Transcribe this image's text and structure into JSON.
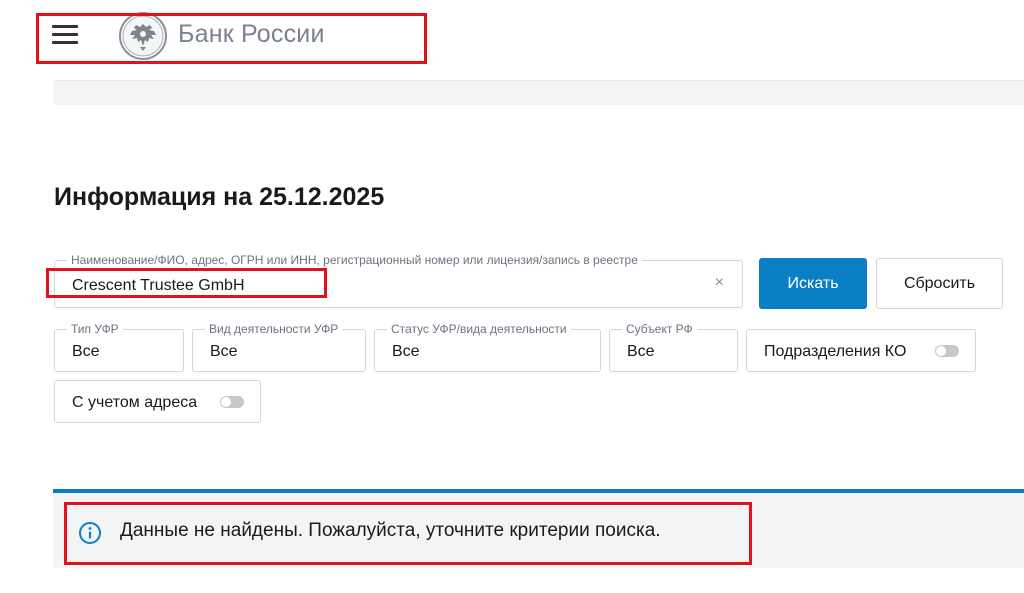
{
  "header": {
    "logo_text": "Банк России",
    "highlight_color": "#e0121b"
  },
  "page": {
    "title": "Информация на 25.12.2025"
  },
  "search": {
    "label": "Наименование/ФИО, адрес, ОГРН или ИНН, регистрационный номер или лицензия/запись в реестре",
    "value": "Crescent Trustee GmbH",
    "clear_glyph": "×",
    "search_button": "Искать",
    "reset_button": "Сбросить"
  },
  "filters": [
    {
      "label": "Тип УФР",
      "value": "Все"
    },
    {
      "label": "Вид деятельности УФР",
      "value": "Все"
    },
    {
      "label": "Статус УФР/вида деятельности",
      "value": "Все"
    },
    {
      "label": "Субъект РФ",
      "value": "Все"
    }
  ],
  "toggles": {
    "branches": {
      "label": "Подразделения КО",
      "on": false
    },
    "address": {
      "label": "С учетом адреса",
      "on": false
    }
  },
  "notice": {
    "icon": "info-icon",
    "text": "Данные не найдены. Пожалуйста, уточните критерии поиска."
  },
  "colors": {
    "accent": "#0a7fc5",
    "background_panel": "#f3f4f5"
  }
}
